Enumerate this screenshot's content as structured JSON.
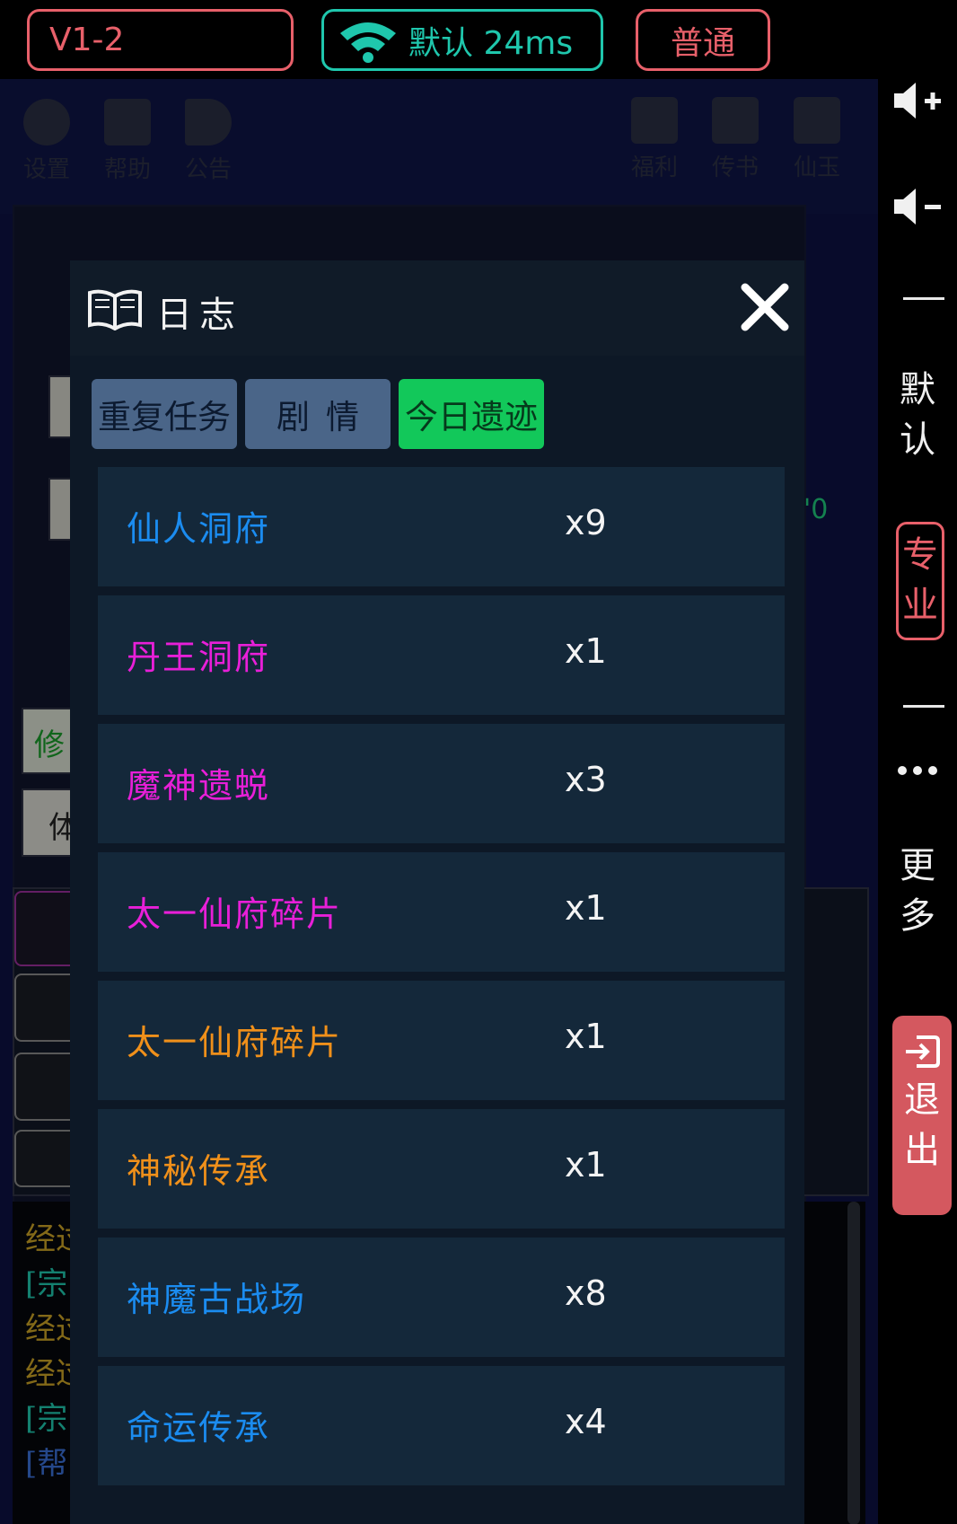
{
  "topbar": {
    "version": "V1-2",
    "network": "默认 24ms",
    "mode": "普通"
  },
  "background": {
    "icons": [
      "设置",
      "帮助",
      "公告",
      "福利",
      "传书",
      "仙玉"
    ],
    "side_chars": [
      "修",
      "体"
    ],
    "side_num": "'0",
    "log_lines": [
      {
        "text": "经过",
        "color": "#c9a226"
      },
      {
        "text": "[宗",
        "color": "#1fc7ad"
      },
      {
        "text": "经过",
        "color": "#c9a226"
      },
      {
        "text": "经过",
        "color": "#c9a226"
      },
      {
        "text": "[宗",
        "color": "#1fc7ad"
      },
      {
        "text": "[帮",
        "color": "#3a6fd6"
      }
    ]
  },
  "sidebar": {
    "vol_up_icon": "volume-up-icon",
    "vol_down_icon": "volume-down-icon",
    "default_label": [
      "默",
      "认"
    ],
    "pro_label": [
      "专",
      "业"
    ],
    "more_label": [
      "更",
      "多"
    ],
    "exit_label": [
      "退",
      "出"
    ],
    "exit_icon": "exit-icon"
  },
  "modal": {
    "title": "日志",
    "title_icon": "book-icon",
    "close_icon": "close-icon",
    "tabs": [
      {
        "label": "重复任务",
        "active": false
      },
      {
        "label": "剧情",
        "active": false
      },
      {
        "label": "今日遗迹",
        "active": true
      }
    ],
    "rows": [
      {
        "name": "仙人洞府",
        "count": "x9",
        "color": "#1b8cf0"
      },
      {
        "name": "丹王洞府",
        "count": "x1",
        "color": "#e81fd8"
      },
      {
        "name": "魔神遗蜕",
        "count": "x3",
        "color": "#e81fd8"
      },
      {
        "name": "太一仙府碎片",
        "count": "x1",
        "color": "#e81fd8"
      },
      {
        "name": "太一仙府碎片",
        "count": "x1",
        "color": "#f0901a"
      },
      {
        "name": "神秘传承",
        "count": "x1",
        "color": "#f0901a"
      },
      {
        "name": "神魔古战场",
        "count": "x8",
        "color": "#1b8cf0"
      },
      {
        "name": "命运传承",
        "count": "x4",
        "color": "#1b8cf0"
      }
    ]
  }
}
